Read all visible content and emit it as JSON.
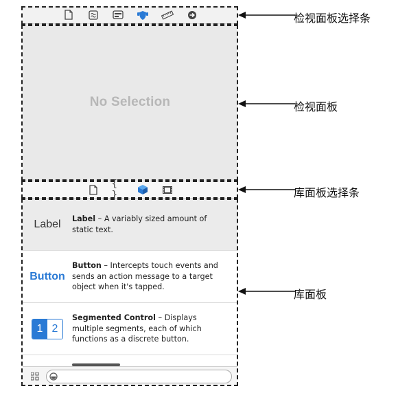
{
  "inspector_selector_bar": {
    "icons": [
      "file-icon",
      "quick-help-icon",
      "identity-icon",
      "attributes-icon",
      "size-ruler-icon",
      "connections-arrow-icon"
    ]
  },
  "inspector_pane": {
    "empty_text": "No Selection"
  },
  "library_selector_bar": {
    "icons": [
      "file-template-icon",
      "code-snippet-icon",
      "object-cube-icon",
      "media-film-icon"
    ],
    "code_snippet_glyph": "{ }"
  },
  "library": {
    "items": [
      {
        "thumb_text": "Label",
        "title": "Label",
        "description": " – A variably sized amount of static text."
      },
      {
        "thumb_text": "Button",
        "title": "Button",
        "description": " – Intercepts touch events and sends an action message to a target object when it's tapped."
      },
      {
        "thumb_segments": [
          "1",
          "2"
        ],
        "title": "Segmented Control",
        "description": " – Displays multiple segments, each of which functions as a discrete button."
      }
    ]
  },
  "filter_bar": {
    "placeholder": ""
  },
  "annotations": {
    "inspector_selector_bar": "检视面板选择条",
    "inspector_pane": "检视面板",
    "library_selector_bar": "库面板选择条",
    "library_pane": "库面板"
  },
  "colors": {
    "accent": "#2a7ad5",
    "inspector_bg": "#e9e9e9",
    "placeholder_text": "#b7b7b7"
  }
}
